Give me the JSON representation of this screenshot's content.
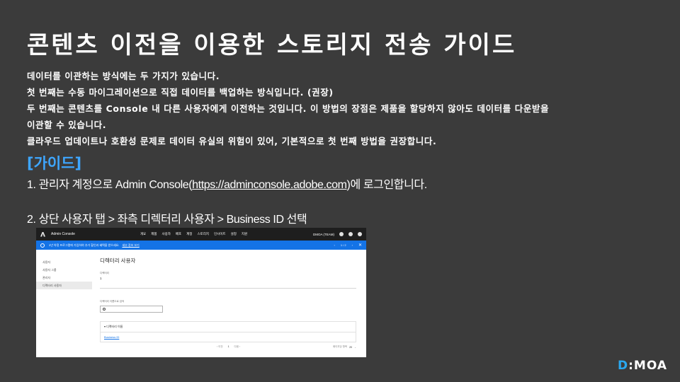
{
  "title": "콘텐츠 이전을 이용한 스토리지 전송 가이드",
  "intro": [
    "데이터를 이관하는 방식에는 두 가지가 있습니다.",
    "첫 번째는 수동 마이그레이션으로 직접 데이터를 백업하는 방식입니다. (권장)",
    "두 번째는 콘텐츠를 Console 내 다른 사용자에게 이전하는 것입니다. 이 방법의 장점은 제품을 할당하지 않아도 데이터를 다운받을",
    "이관할 수 있습니다.",
    "클라우드 업데이트나 호환성 문제로 데이터 유실의 위험이 있어, 기본적으로 첫 번째 방법을 권장합니다."
  ],
  "guide_heading": "[가이드]",
  "step1": {
    "prefix": "1. 관리자 계정으로 Admin Console(",
    "link": "https://adminconsole.adobe.com",
    "suffix": ")에 로그인합니다."
  },
  "step2": "2. 상단 사용자 탭 > 좌측 디렉터리 사용자 > Business ID 선택",
  "screenshot": {
    "brand": "Admin Console",
    "nav": [
      "개요",
      "제품",
      "사용자",
      "배포",
      "계정",
      "스토리지",
      "인사이트",
      "설정",
      "지원"
    ],
    "org": "DMOA (TEAM)",
    "banner_text": "3년 약정 프로그램에 가입하여 추가 할인과 혜택을 받으세요.",
    "banner_link": "세부 정보 보기",
    "banner_page": "1 / 2",
    "sidebar": [
      "사용자",
      "사용자 그룹",
      "관리자",
      "디렉터리 사용자"
    ],
    "main_title": "디렉터리 사용자",
    "dir_label": "디렉터리",
    "dir_value": "1",
    "search_label": "디렉터리 이름으로 검색",
    "card_head": "디렉터리 이름",
    "card_row": "Business ID",
    "pager_prev": "이전",
    "pager_page": "1",
    "pager_next": "다음",
    "pager_size_label": "페이지당 항목",
    "pager_size": "20"
  },
  "logo": {
    "prefix": "D",
    "rest": ":MOA"
  }
}
